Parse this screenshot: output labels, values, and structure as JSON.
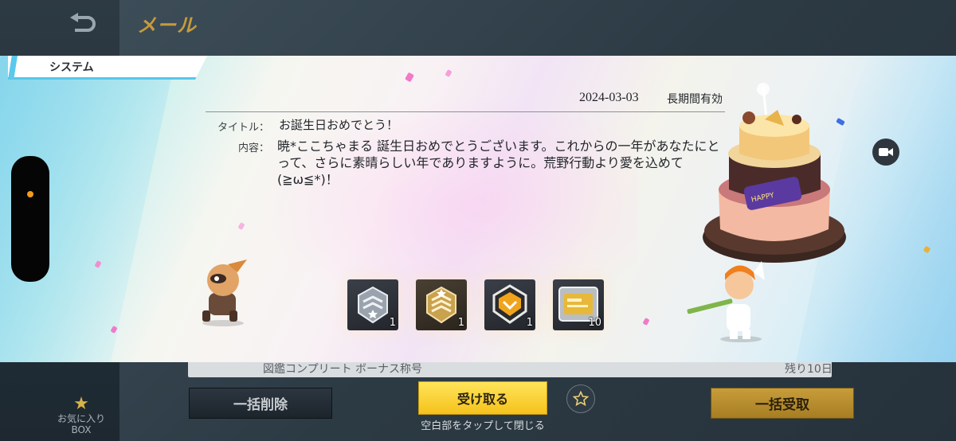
{
  "screen": {
    "title": "メール",
    "behind_row_text": "図鑑コンプリート ボーナス称号",
    "behind_row_date": "残り10日",
    "favorites_label": "お気に入り",
    "favorites_sub": "BOX"
  },
  "modal": {
    "tab_label": "システム",
    "date": "2024-03-03",
    "validity": "長期間有効",
    "title_label": "タイトル：",
    "title_value": "お誕生日おめでとう！",
    "body_label": "内容：",
    "body_value": "暁*ここちゃまる 誕生日おめでとうございます。これからの一年があなたにとって、さらに素晴らしい年でありますように。荒野行動より愛を込めて(≧ω≦*)！",
    "rewards": [
      {
        "icon": "silver-rank-badge-icon",
        "count": "1"
      },
      {
        "icon": "gold-rank-badge-icon",
        "count": "1"
      },
      {
        "icon": "gold-shield-badge-icon",
        "count": "1"
      },
      {
        "icon": "gold-card-icon",
        "count": "10"
      }
    ]
  },
  "buttons": {
    "bulk_delete": "一括削除",
    "receive": "受け取る",
    "bulk_receive": "一括受取",
    "tap_hint": "空白部をタップして閉じる"
  },
  "colors": {
    "receive_yellow": "#f5c21b",
    "bulk_receive_gold": "#c79d3b",
    "tab_accent": "#5bc8ec",
    "title_orange": "#c79b3b"
  }
}
